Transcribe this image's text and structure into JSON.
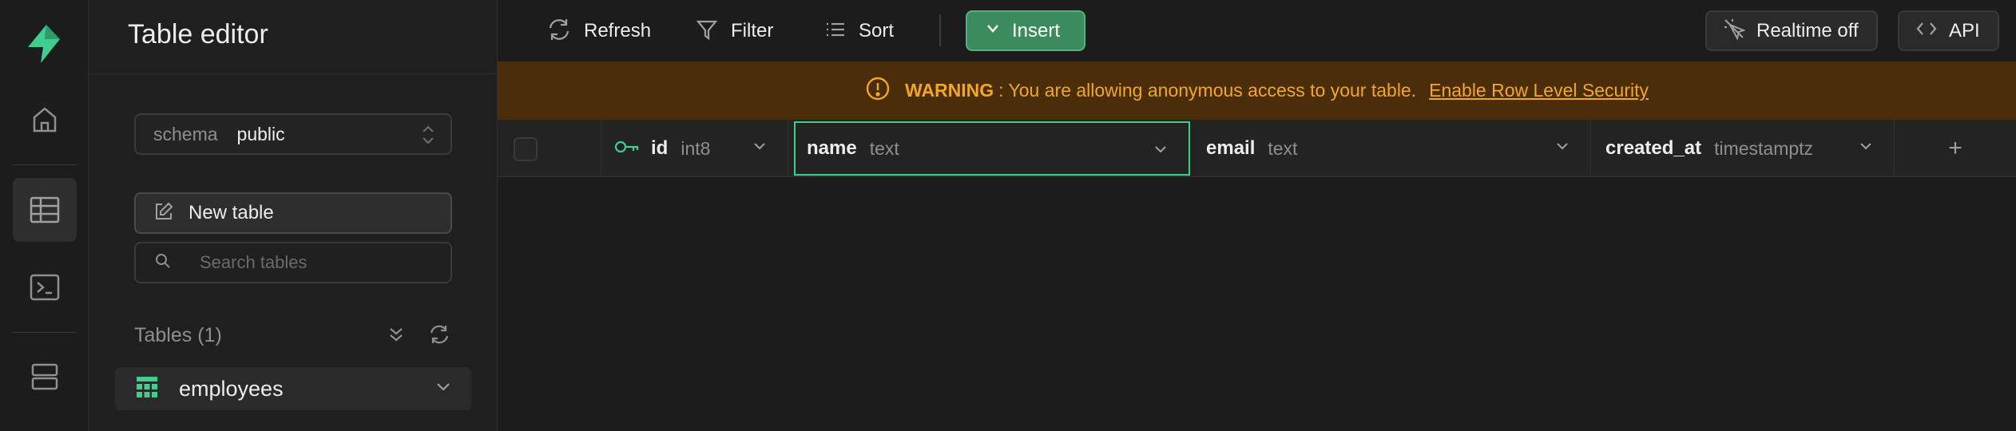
{
  "sidebar": {
    "title": "Table editor",
    "schema_label": "schema",
    "schema_value": "public",
    "new_table_label": "New table",
    "search_placeholder": "Search tables",
    "tables_header": "Tables (1)",
    "tables": [
      {
        "name": "employees"
      }
    ]
  },
  "toolbar": {
    "refresh_label": "Refresh",
    "filter_label": "Filter",
    "sort_label": "Sort",
    "insert_label": "Insert",
    "realtime_label": "Realtime off",
    "api_label": "API"
  },
  "warning": {
    "title": "WARNING",
    "message": ": You are allowing anonymous access to your table.",
    "link": "Enable Row Level Security"
  },
  "grid": {
    "columns": [
      {
        "name": "id",
        "type": "int8",
        "primary_key": true
      },
      {
        "name": "name",
        "type": "text",
        "selected": true
      },
      {
        "name": "email",
        "type": "text"
      },
      {
        "name": "created_at",
        "type": "timestamptz"
      }
    ],
    "add_column_label": "+"
  },
  "colors": {
    "accent": "#3ecf8e",
    "insert_bg": "#3c8b5e",
    "warning_bg": "#4a2e0a",
    "warning_text": "#f5a524"
  }
}
